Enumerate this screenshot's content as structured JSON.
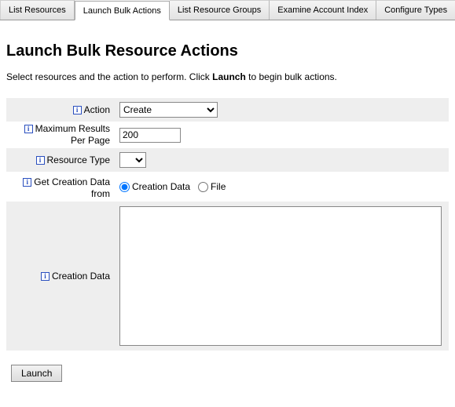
{
  "tabs": {
    "t0": "List Resources",
    "t1": "Launch Bulk Actions",
    "t2": "List Resource Groups",
    "t3": "Examine Account Index",
    "t4": "Configure Types"
  },
  "heading": "Launch Bulk Resource Actions",
  "intro_pre": "Select resources and the action to perform. Click ",
  "intro_bold": "Launch",
  "intro_post": " to begin bulk actions.",
  "labels": {
    "action": "Action",
    "max1": "Maximum Results",
    "max2": "Per Page",
    "rtype": "Resource Type",
    "getfrom1": "Get Creation Data",
    "getfrom2": "from",
    "cdata": "Creation Data"
  },
  "fields": {
    "action_value": "Create",
    "max_value": "200",
    "radio_cdata": "Creation Data",
    "radio_file": "File",
    "textarea_value": ""
  },
  "buttons": {
    "launch": "Launch"
  }
}
